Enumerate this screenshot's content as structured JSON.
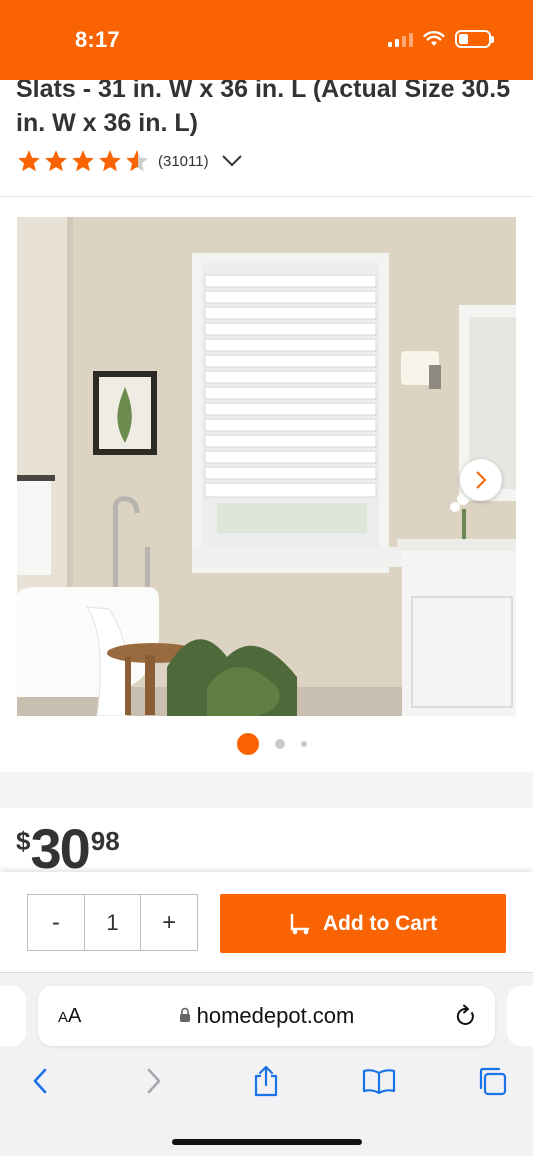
{
  "status_bar": {
    "time": "8:17",
    "background": "#f96302"
  },
  "product": {
    "title": "Slats - 31 in. W x 36 in. L (Actual Size 30.5 in. W x 36 in. L)",
    "rating": 4.5,
    "review_count": "(31011)",
    "accent_color": "#f96302"
  },
  "gallery": {
    "image_icon": "product-photo",
    "dots_count": 3,
    "active_dot": 0
  },
  "price": {
    "symbol": "$",
    "dollars": "30",
    "cents": "98"
  },
  "cart": {
    "quantity_minus": "-",
    "quantity": "1",
    "quantity_plus": "+",
    "add_to_cart_label": "Add to Cart"
  },
  "browser": {
    "text_size_label_small": "A",
    "text_size_label_large": "A",
    "url": "homedepot.com"
  }
}
